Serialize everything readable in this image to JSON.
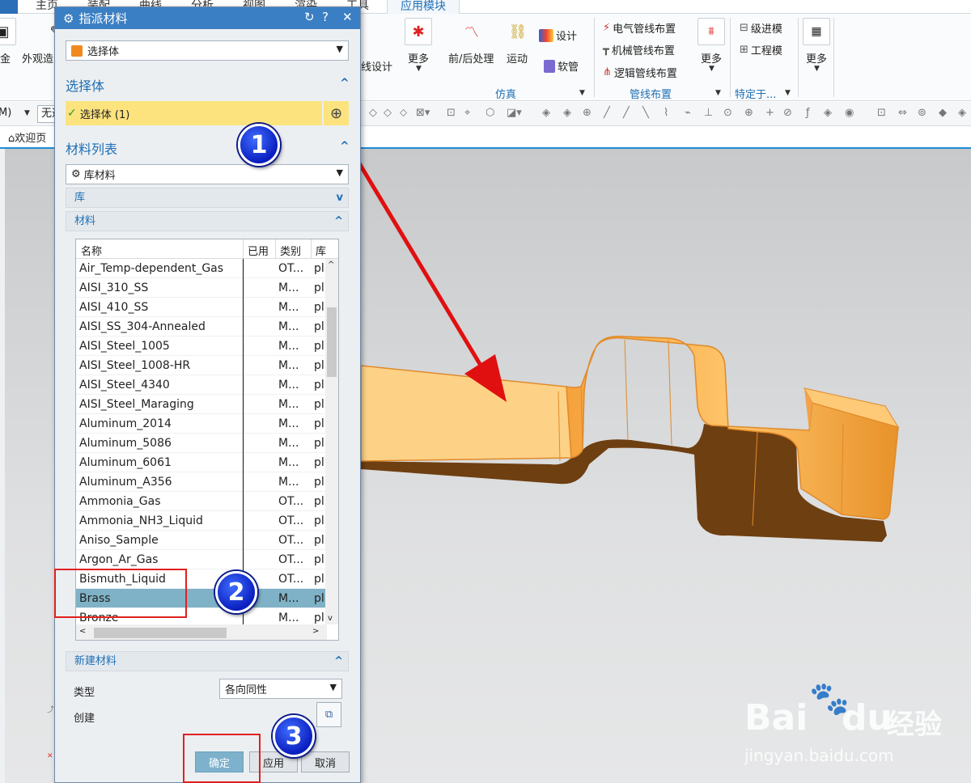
{
  "ribbon": {
    "tabs": [
      "主页",
      "装配",
      "曲线",
      "分析",
      "视图",
      "渲染",
      "工具",
      "应用模块"
    ],
    "active_tab": "应用模块",
    "left_cut": [
      "金",
      "外观造"
    ],
    "left_item": "线设计",
    "simulation_group": {
      "label": "仿真",
      "items": [
        "更多",
        "前/后处理",
        "运动",
        "设计",
        "软管"
      ]
    },
    "routing_group": {
      "label": "管线布置",
      "items": [
        "电气管线布置",
        "机械管线布置",
        "逻辑管线布置",
        "更多"
      ]
    },
    "specific_group": {
      "label": "特定于...",
      "items": [
        "级进模",
        "工程模"
      ]
    },
    "last_more": "更多"
  },
  "toolbar": {
    "left_fragment": "M)",
    "filter_value": "无选"
  },
  "tab_strip": {
    "welcome": "欢迎页"
  },
  "dialog": {
    "title": "指派材料",
    "type_combo": "选择体",
    "section_select": {
      "title": "选择体",
      "status": "选择体 (1)"
    },
    "section_materials": {
      "title": "材料列表",
      "source_combo": "库材料",
      "library_label": "库",
      "materials_label": "材料",
      "columns": [
        "名称",
        "已用",
        "类别",
        "库"
      ],
      "rows": [
        {
          "name": "Air_Temp-dependent_Gas",
          "cat": "OT...",
          "lib": "pl"
        },
        {
          "name": "AISI_310_SS",
          "cat": "M...",
          "lib": "pl"
        },
        {
          "name": "AISI_410_SS",
          "cat": "M...",
          "lib": "pl"
        },
        {
          "name": "AISI_SS_304-Annealed",
          "cat": "M...",
          "lib": "pl"
        },
        {
          "name": "AISI_Steel_1005",
          "cat": "M...",
          "lib": "pl"
        },
        {
          "name": "AISI_Steel_1008-HR",
          "cat": "M...",
          "lib": "pl"
        },
        {
          "name": "AISI_Steel_4340",
          "cat": "M...",
          "lib": "pl"
        },
        {
          "name": "AISI_Steel_Maraging",
          "cat": "M...",
          "lib": "pl"
        },
        {
          "name": "Aluminum_2014",
          "cat": "M...",
          "lib": "pl"
        },
        {
          "name": "Aluminum_5086",
          "cat": "M...",
          "lib": "pl"
        },
        {
          "name": "Aluminum_6061",
          "cat": "M...",
          "lib": "pl"
        },
        {
          "name": "Aluminum_A356",
          "cat": "M...",
          "lib": "pl"
        },
        {
          "name": "Ammonia_Gas",
          "cat": "OT...",
          "lib": "pl"
        },
        {
          "name": "Ammonia_NH3_Liquid",
          "cat": "OT...",
          "lib": "pl"
        },
        {
          "name": "Aniso_Sample",
          "cat": "OT...",
          "lib": "pl"
        },
        {
          "name": "Argon_Ar_Gas",
          "cat": "OT...",
          "lib": "pl"
        },
        {
          "name": "Bismuth_Liquid",
          "cat": "OT...",
          "lib": "pl"
        },
        {
          "name": "Brass",
          "cat": "M...",
          "lib": "pl",
          "selected": true
        },
        {
          "name": "Bronze",
          "cat": "M...",
          "lib": "pl"
        }
      ]
    },
    "section_new": {
      "title": "新建材料",
      "type_label": "类型",
      "type_value": "各向同性",
      "create_label": "创建"
    },
    "buttons": {
      "ok": "确定",
      "apply": "应用",
      "cancel": "取消"
    }
  },
  "markers": [
    "1",
    "2",
    "3"
  ],
  "watermark": {
    "brand": "Bai",
    "brand2": "du",
    "cn": "经验",
    "url": "jingyan.baidu.com"
  },
  "colors": {
    "accent": "#1e6fb5",
    "title_bar": "#3a7fc4",
    "select_bar": "#fce37e",
    "selected_row": "#7fb2c6",
    "model": "#f7a844",
    "arrow": "#e01010"
  }
}
